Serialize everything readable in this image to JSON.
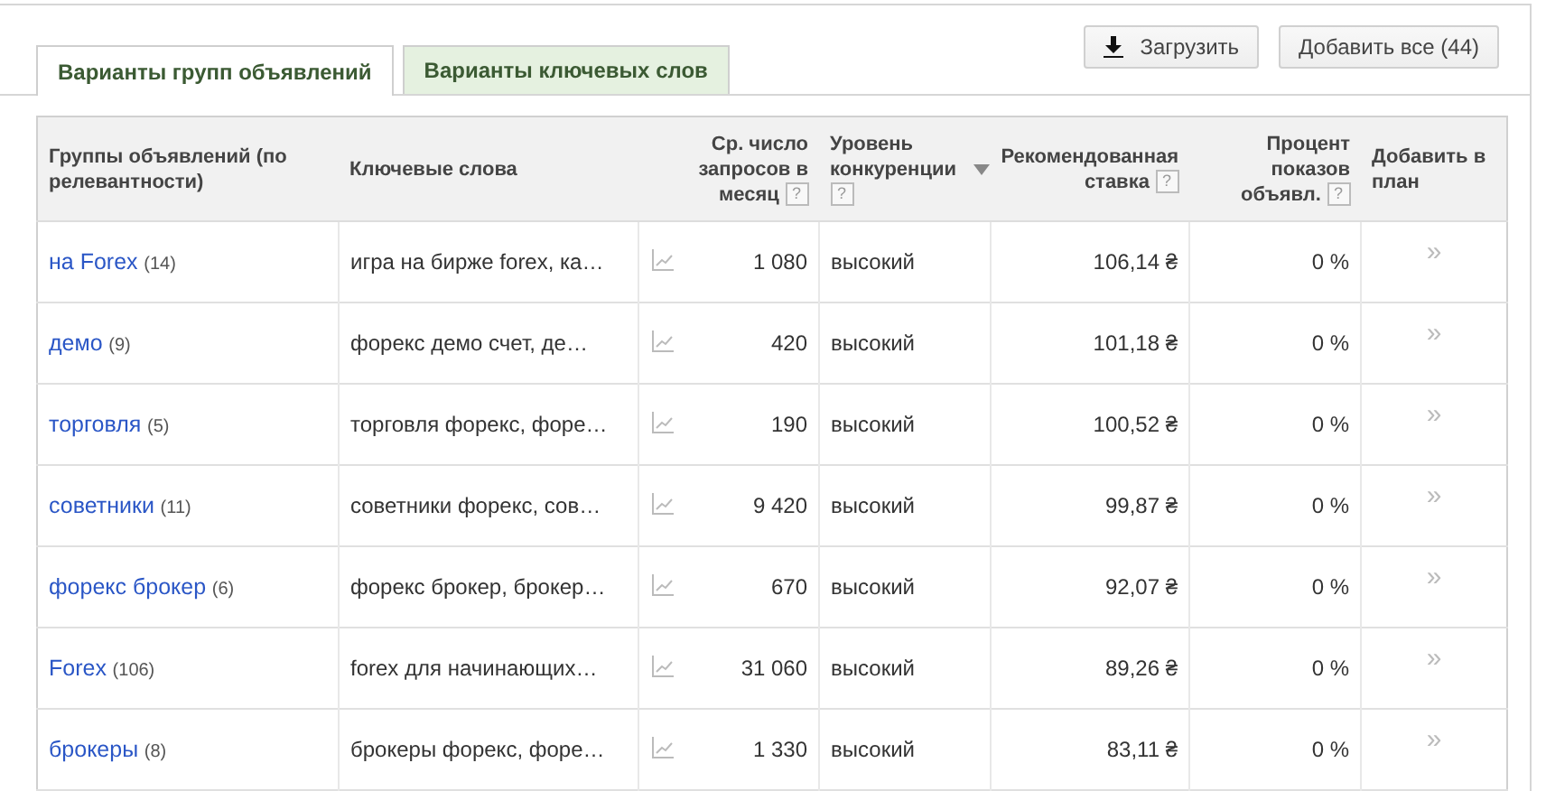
{
  "tabs": [
    {
      "label": "Варианты групп объявлений",
      "selected": true
    },
    {
      "label": "Варианты ключевых слов",
      "selected": false
    }
  ],
  "buttons": [
    {
      "kind": "download",
      "label": "Загрузить"
    },
    {
      "kind": "plain",
      "label": "Добавить все (44)"
    }
  ],
  "table": {
    "columns": [
      {
        "label": "Группы объявлений (по релевантности)",
        "help": false,
        "sorted": false
      },
      {
        "label": "Ключевые слова",
        "help": false,
        "sorted": false
      },
      {
        "label": "Ср. число запросов в месяц",
        "help": true,
        "sorted": false
      },
      {
        "label": "Уровень конкуренции",
        "help": true,
        "sorted": false
      },
      {
        "label": "Рекомендованная ставка",
        "help": true,
        "sorted": true
      },
      {
        "label": "Процент показов объявл.",
        "help": true,
        "sorted": false
      },
      {
        "label": "Добавить в план",
        "help": false,
        "sorted": false
      }
    ],
    "help_mark": "?",
    "rows": [
      {
        "group": "на Forex",
        "count": "(14)",
        "keywords": "игра на бирже forex, ка…",
        "searches": "1 080",
        "competition": "высокий",
        "bid": "106,14 ₴",
        "share": "0 %",
        "add": "»"
      },
      {
        "group": "демо",
        "count": "(9)",
        "keywords": "форекс демо счет, де…",
        "searches": "420",
        "competition": "высокий",
        "bid": "101,18 ₴",
        "share": "0 %",
        "add": "»"
      },
      {
        "group": "торговля",
        "count": "(5)",
        "keywords": "торговля форекс, форе…",
        "searches": "190",
        "competition": "высокий",
        "bid": "100,52 ₴",
        "share": "0 %",
        "add": "»"
      },
      {
        "group": "советники",
        "count": "(11)",
        "keywords": "советники форекс, сов…",
        "searches": "9 420",
        "competition": "высокий",
        "bid": "99,87 ₴",
        "share": "0 %",
        "add": "»"
      },
      {
        "group": "форекс брокер",
        "count": "(6)",
        "keywords": "форекс брокер, брокер…",
        "searches": "670",
        "competition": "высокий",
        "bid": "92,07 ₴",
        "share": "0 %",
        "add": "»"
      },
      {
        "group": "Forex",
        "count": "(106)",
        "keywords": "forex для начинающих…",
        "searches": "31 060",
        "competition": "высокий",
        "bid": "89,26 ₴",
        "share": "0 %",
        "add": "»"
      },
      {
        "group": "брокеры",
        "count": "(8)",
        "keywords": "брокеры форекс, форе…",
        "searches": "1 330",
        "competition": "высокий",
        "bid": "83,11 ₴",
        "share": "0 %",
        "add": "»"
      }
    ]
  }
}
